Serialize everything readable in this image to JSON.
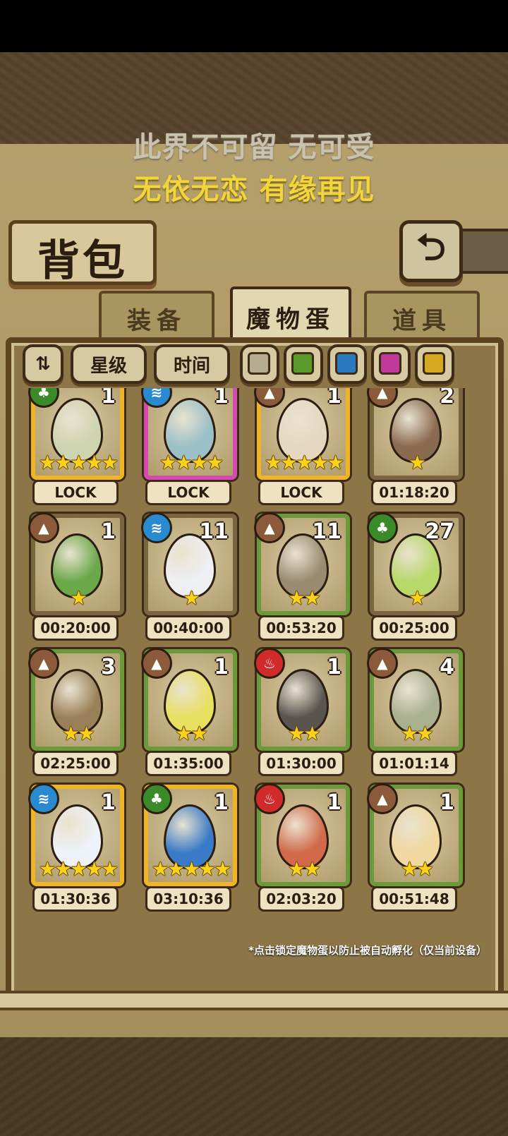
{
  "banner": {
    "line1": "此界不可留 无可受",
    "line2": "无依无恋 有缘再见"
  },
  "title": "背包",
  "back_glyph": "⮌",
  "tabs": [
    {
      "label": "装备"
    },
    {
      "label": "魔物蛋"
    },
    {
      "label": "道具"
    }
  ],
  "filters": {
    "sort_glyph": "⇅",
    "star_label": "星级",
    "time_label": "时间"
  },
  "swatch_colors": [
    "#b8ac90",
    "#5a9a2a",
    "#2a7ac0",
    "#c03a9a",
    "#d4a820"
  ],
  "eggs": [
    {
      "count": "1",
      "stars": "★★★★★",
      "timer": "LOCK",
      "frame": "gold",
      "color": "#cfd4b0",
      "element": "leaf"
    },
    {
      "count": "1",
      "stars": "★★★★",
      "timer": "LOCK",
      "frame": "pink",
      "color": "#9ac0c8",
      "element": "water"
    },
    {
      "count": "1",
      "stars": "★★★★★",
      "timer": "LOCK",
      "frame": "gold",
      "color": "#e6d8c0",
      "element": "earth"
    },
    {
      "count": "2",
      "stars": "★",
      "timer": "01:18:20",
      "frame": "brown",
      "color": "#8a6a50",
      "element": "earth"
    },
    {
      "count": "1",
      "stars": "★",
      "timer": "00:20:00",
      "frame": "brown",
      "color": "#6aa84a",
      "element": "earth"
    },
    {
      "count": "11",
      "stars": "★",
      "timer": "00:40:00",
      "frame": "brown",
      "color": "#eef0f4",
      "element": "water"
    },
    {
      "count": "11",
      "stars": "★★",
      "timer": "00:53:20",
      "frame": "green",
      "color": "#9a8a70",
      "element": "earth"
    },
    {
      "count": "27",
      "stars": "★",
      "timer": "00:25:00",
      "frame": "brown",
      "color": "#b8d86a",
      "element": "leaf"
    },
    {
      "count": "3",
      "stars": "★★",
      "timer": "02:25:00",
      "frame": "green",
      "color": "#9a8058",
      "element": "earth"
    },
    {
      "count": "1",
      "stars": "★★",
      "timer": "01:35:00",
      "frame": "green",
      "color": "#e8e060",
      "element": "earth"
    },
    {
      "count": "1",
      "stars": "★★",
      "timer": "01:30:00",
      "frame": "green",
      "color": "#5a5450",
      "element": "fire"
    },
    {
      "count": "4",
      "stars": "★★",
      "timer": "01:01:14",
      "frame": "green",
      "color": "#a8b090",
      "element": "earth"
    },
    {
      "count": "1",
      "stars": "★★★★★",
      "timer": "01:30:36",
      "frame": "gold",
      "color": "#eef2fa",
      "element": "water"
    },
    {
      "count": "1",
      "stars": "★★★★★",
      "timer": "03:10:36",
      "frame": "gold",
      "color": "#3a7ac8",
      "element": "leaf"
    },
    {
      "count": "1",
      "stars": "★★",
      "timer": "02:03:20",
      "frame": "green",
      "color": "#d06a4a",
      "element": "fire"
    },
    {
      "count": "1",
      "stars": "★★",
      "timer": "00:51:48",
      "frame": "green",
      "color": "#f0d8a0",
      "element": "earth"
    }
  ],
  "notice": "*点击锁定魔物蛋以防止被自动孵化（仅当前设备）"
}
